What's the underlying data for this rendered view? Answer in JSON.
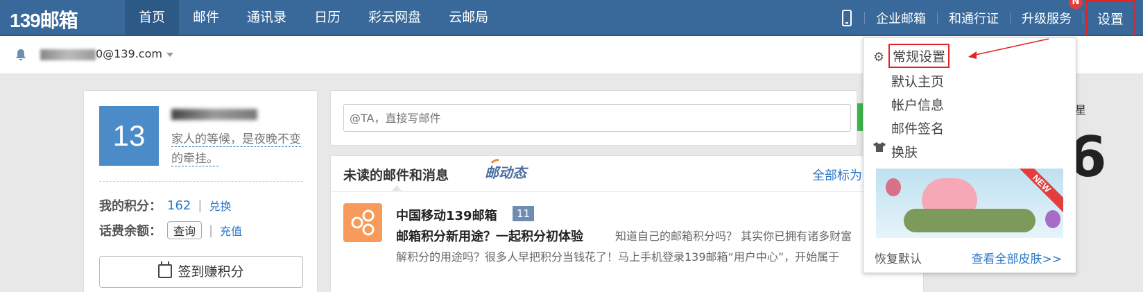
{
  "app": {
    "logo": "139邮箱"
  },
  "nav": {
    "items": [
      {
        "label": "首页",
        "active": true
      },
      {
        "label": "邮件"
      },
      {
        "label": "通讯录"
      },
      {
        "label": "日历"
      },
      {
        "label": "彩云网盘"
      },
      {
        "label": "云邮局"
      }
    ]
  },
  "header_right": {
    "enterprise_mail": "企业邮箱",
    "hetong": "和通行证",
    "upgrade": "升级服务",
    "upgrade_badge": "N",
    "settings": "设置"
  },
  "subbar": {
    "account_suffix": "0@139.com"
  },
  "profile": {
    "level": "13",
    "signature": "家人的等候，是夜晚不变的牵挂。",
    "points_label": "我的积分：",
    "points_value": "162",
    "exchange": "兑换",
    "balance_label": "话费余额：",
    "query": "查询",
    "recharge": "充值",
    "checkin": "签到赚积分"
  },
  "compose": {
    "placeholder": "@TA，直接写邮件"
  },
  "messages": {
    "title": "未读的邮件和消息",
    "dongtai": "邮动态",
    "mark_all": "全部标为",
    "item": {
      "sender": "中国移动139邮箱",
      "count": "11",
      "subject": "邮箱积分新用途？一起积分初体验",
      "preview": "知道自己的邮箱积分吗？ 其实你已拥有诸多财富",
      "preview2": "解积分的用途吗？很多人早把积分当钱花了！马上手机登录139邮箱“用户中心”，开始属于"
    }
  },
  "right_peek": {
    "small": "星",
    "big": "6"
  },
  "settings_menu": {
    "items": [
      "常规设置",
      "默认主页",
      "帐户信息",
      "邮件签名",
      "换肤"
    ],
    "banner_badge": "NEW",
    "restore_default": "恢复默认",
    "view_all_skins": "查看全部皮肤>>"
  },
  "colors": {
    "topbar": "#38699a",
    "accent_blue": "#2c78c8",
    "highlight_red": "#e52222",
    "avatar_blue": "#4b8cc8"
  }
}
